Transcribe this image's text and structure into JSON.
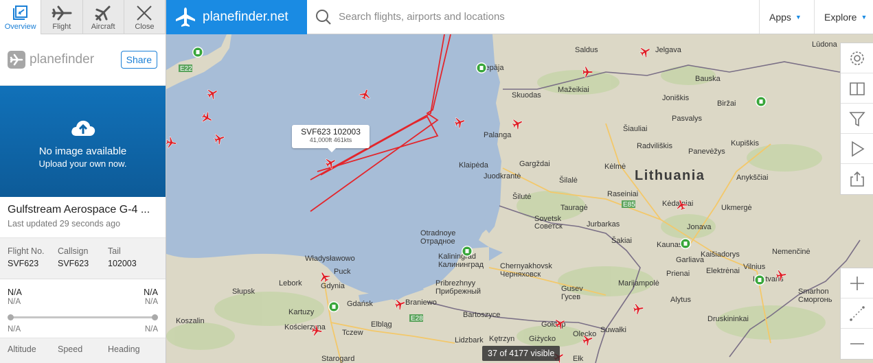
{
  "tabs": [
    {
      "label": "Overview",
      "icon": "overview-icon",
      "active": true
    },
    {
      "label": "Flight",
      "icon": "plane-icon"
    },
    {
      "label": "Aircraft",
      "icon": "aircraft-icon"
    },
    {
      "label": "Close",
      "icon": "close-icon"
    }
  ],
  "panel": {
    "brand": "planefinder",
    "share_label": "Share",
    "photo_title": "No image available",
    "photo_subtitle": "Upload your own now.",
    "aircraft_name": "Gulfstream Aerospace G-4 ...",
    "last_updated": "Last updated 29 seconds ago",
    "ids": [
      {
        "key": "Flight No.",
        "value": "SVF623"
      },
      {
        "key": "Callsign",
        "value": "SVF623"
      },
      {
        "key": "Tail",
        "value": "102003"
      }
    ],
    "route": {
      "origin": "N/A",
      "origin_sub": "N/A",
      "dest": "N/A",
      "dest_sub": "N/A",
      "origin_bottom": "N/A",
      "dest_bottom": "N/A"
    },
    "stats_headers": [
      "Altitude",
      "Speed",
      "Heading"
    ]
  },
  "topbar": {
    "brand": "planefinder.net",
    "search_placeholder": "Search flights, airports and locations",
    "apps_label": "Apps",
    "explore_label": "Explore"
  },
  "map": {
    "tooltip_title": "SVF623 102003",
    "tooltip_detail": "41,000ft 461kts",
    "visible_text": "37 of 4177 visible",
    "country_label": "Lithuania",
    "places": [
      "Saldus",
      "Jelgava",
      "Liepāja",
      "Bauska",
      "Lūdona",
      "Mažeikiai",
      "Joniškis",
      "Skuodas",
      "Biržai",
      "Pasvalys",
      "Palanga",
      "Šiauliai",
      "Kupiškis",
      "Radviliškis",
      "Panevėžys",
      "Klaipėda",
      "Gargždai",
      "Kėlmė",
      "Juodkrantė",
      "Šilalė",
      "Anykščiai",
      "Raseiniai",
      "Šilutė",
      "Kėdainiai",
      "Tauragė",
      "Jurbarkas",
      "Ukmergė",
      "Sovetsk",
      "Советск",
      "Jonava",
      "Otradnoye",
      "Отрадное",
      "Šakiai",
      "Kaunas",
      "Nemenčinė",
      "Kaliningrad",
      "Калининград",
      "Chernyakhovsk",
      "Черняховск",
      "Kaišiadorys",
      "Vilnius",
      "Władysławowo",
      "Puck",
      "Gdynia",
      "Gdańsk",
      "Garliava",
      "Elektrėnai",
      "Lentvaris",
      "Prienai",
      "Pribrezhnyy",
      "Прибрежный",
      "Gusev",
      "Гусев",
      "Marijampolė",
      "Smarhon",
      "Сморгонь",
      "Lebork",
      "Słupsk",
      "Kartuzy",
      "Braniewo",
      "Bartoszyce",
      "Alytus",
      "Druskininkai",
      "Koszalin",
      "Kościerzyna",
      "Tczew",
      "Elbląg",
      "Lidzbark",
      "Kętrzyn",
      "Giżycko",
      "Olecko",
      "Suwałki",
      "Starogard",
      "Ełk",
      "Gołdap",
      "E22",
      "E28",
      "E85"
    ]
  }
}
